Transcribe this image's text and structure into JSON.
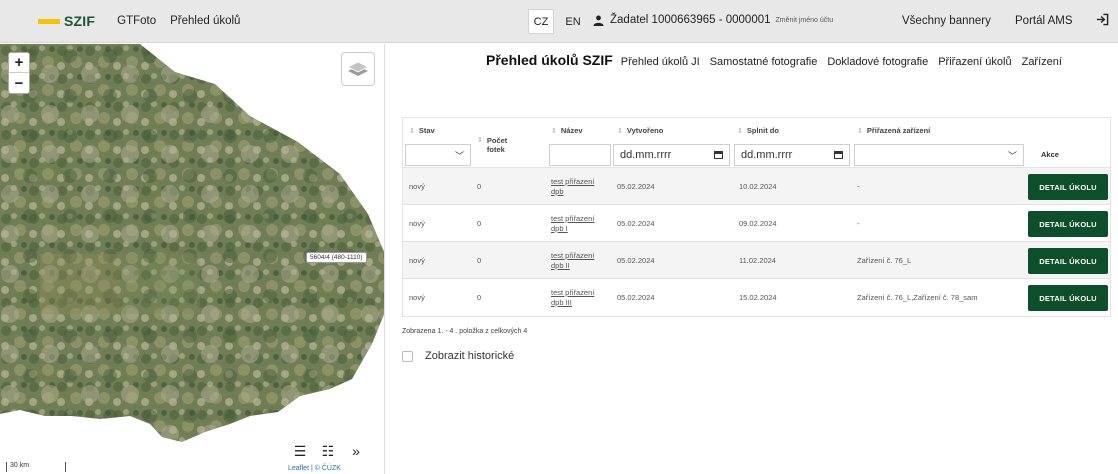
{
  "header": {
    "logo_text": "SZIF",
    "nav": [
      "GTFoto",
      "Přehled úkolů"
    ],
    "languages": [
      "CZ",
      "EN"
    ],
    "active_language": "CZ",
    "user": "Žadatel 1000663965 - 0000001",
    "change_name": "Změnit jméno účtu",
    "banners": "Všechny bannery",
    "portal": "Portál AMS"
  },
  "map": {
    "parcel_label": "5604/4 (480-1110)",
    "scale": "30 km",
    "attribution": "Leaflet | © ČÚZK"
  },
  "tabs": [
    "Přehled úkolů SZIF",
    "Přehled úkolů JI",
    "Samostatné fotografie",
    "Dokladové fotografie",
    "Přiřazení úkolů",
    "Zařízení"
  ],
  "table": {
    "columns": {
      "stav": "Stav",
      "pocet": "Počet fotek",
      "nazev": "Název",
      "vytvoreno": "Vytvořeno",
      "splnit": "Splnit do",
      "zarizeni": "Přiřazená zařízení",
      "akce": "Akce"
    },
    "date_placeholder": "dd.mm.rrrr",
    "button_label": "DETAIL ÚKOLU",
    "rows": [
      {
        "stav": "nový",
        "pocet": "0",
        "nazev_1": "test přiřazení",
        "nazev_2": "dpb",
        "vytvoreno": "05.02.2024",
        "splnit": "10.02.2024",
        "zarizeni": "-"
      },
      {
        "stav": "nový",
        "pocet": "0",
        "nazev_1": "test přiřazení",
        "nazev_2": "dpb I",
        "vytvoreno": "05.02.2024",
        "splnit": "09.02.2024",
        "zarizeni": "-"
      },
      {
        "stav": "nový",
        "pocet": "0",
        "nazev_1": "test přiřazení",
        "nazev_2": "dpb II",
        "vytvoreno": "05.02.2024",
        "splnit": "11.02.2024",
        "zarizeni": "Zařízení č. 76_L"
      },
      {
        "stav": "nový",
        "pocet": "0",
        "nazev_1": "test přiřazení",
        "nazev_2": "dpb III",
        "vytvoreno": "05.02.2024",
        "splnit": "15.02.2024",
        "zarizeni": "Zařízení č. 76_L,Zařízení č. 78_sam"
      }
    ]
  },
  "summary": "Zobrazena 1. - 4 . položka z celkových 4",
  "show_history": "Zobrazit historické"
}
